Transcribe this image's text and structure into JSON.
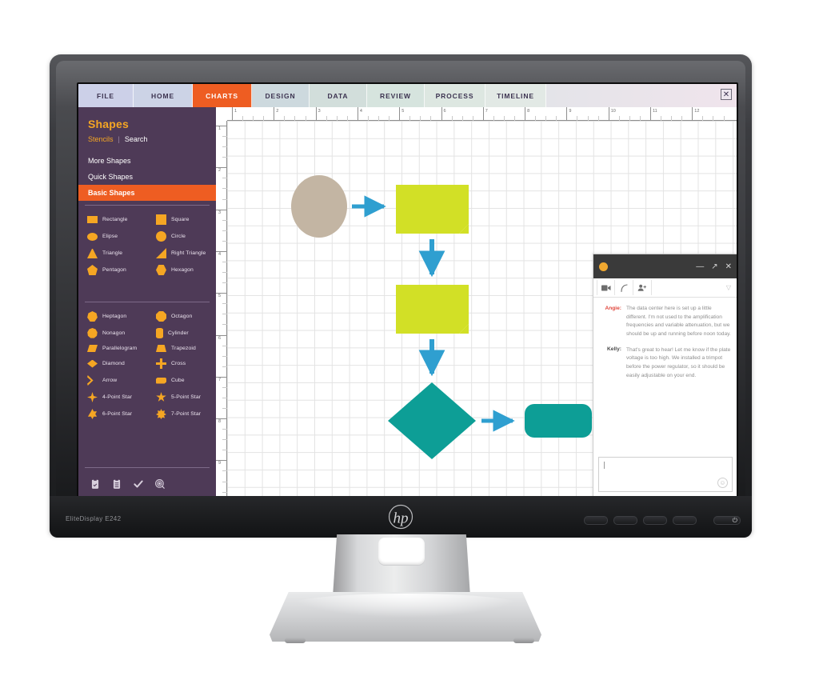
{
  "monitor": {
    "model_label": "EliteDisplay E242",
    "brand": "hp",
    "power_glyph": "⏻",
    "osd_button_count": 4
  },
  "ribbon": {
    "tabs": [
      {
        "label": "FILE",
        "active": false
      },
      {
        "label": "HOME",
        "active": false
      },
      {
        "label": "CHARTS",
        "active": true
      },
      {
        "label": "DESIGN",
        "active": false
      },
      {
        "label": "DATA",
        "active": false
      },
      {
        "label": "REVIEW",
        "active": false
      },
      {
        "label": "PROCESS",
        "active": false
      },
      {
        "label": "TIMELINE",
        "active": false
      }
    ],
    "close_label": "✕",
    "active_color": "#ee5d22"
  },
  "sidebar": {
    "title": "Shapes",
    "subnav": {
      "stencils": "Stencils",
      "separator": "|",
      "search": "Search"
    },
    "links": [
      {
        "label": "More Shapes",
        "active": false
      },
      {
        "label": "Quick Shapes",
        "active": false
      },
      {
        "label": "Basic Shapes",
        "active": true
      }
    ],
    "accent_color": "#f5a623",
    "panel_color": "#4e3a57",
    "group1": [
      {
        "label": "Rectangle",
        "shape": "rectangle"
      },
      {
        "label": "Square",
        "shape": "square"
      },
      {
        "label": "Elipse",
        "shape": "elipse"
      },
      {
        "label": "Circle",
        "shape": "circle"
      },
      {
        "label": "Triangle",
        "shape": "triangle"
      },
      {
        "label": "Right Triangle",
        "shape": "right-triangle"
      },
      {
        "label": "Pentagon",
        "shape": "pentagon"
      },
      {
        "label": "Hexagon",
        "shape": "hexagon"
      }
    ],
    "group2": [
      {
        "label": "Heptagon",
        "shape": "heptagon"
      },
      {
        "label": "Octagon",
        "shape": "octagon"
      },
      {
        "label": "Nonagon",
        "shape": "nonagon"
      },
      {
        "label": "Cylinder",
        "shape": "cylinder"
      },
      {
        "label": "Parallelogram",
        "shape": "parallelogram"
      },
      {
        "label": "Trapezoid",
        "shape": "trapezoid"
      },
      {
        "label": "Diamond",
        "shape": "diamond"
      },
      {
        "label": "Cross",
        "shape": "cross"
      },
      {
        "label": "Arrow",
        "shape": "arrow"
      },
      {
        "label": "Cube",
        "shape": "cube"
      },
      {
        "label": "4-Point Star",
        "shape": "star4"
      },
      {
        "label": "5-Point Star",
        "shape": "star5"
      },
      {
        "label": "6-Point Star",
        "shape": "star6"
      },
      {
        "label": "7-Point Star",
        "shape": "star7"
      }
    ],
    "tools": [
      {
        "icon": "clipboard-check-icon"
      },
      {
        "icon": "clipboard-icon"
      },
      {
        "icon": "checkmark-icon"
      },
      {
        "icon": "target-icon"
      }
    ]
  },
  "canvas": {
    "ruler_h_labels": [
      "1",
      "2",
      "3",
      "4",
      "5",
      "6",
      "7",
      "8",
      "9",
      "10",
      "11",
      "12"
    ],
    "ruler_v_labels": [
      "1",
      "2",
      "3",
      "4",
      "5",
      "6",
      "7",
      "8",
      "9"
    ],
    "grid": true,
    "diagram": {
      "connector_color": "#2f9fd0",
      "nodes": [
        {
          "name": "start-ellipse",
          "shape": "ellipse",
          "color": "#c3b5a3"
        },
        {
          "name": "process-node-1",
          "shape": "folded-corner",
          "color": "#d2e026"
        },
        {
          "name": "process-node-2",
          "shape": "folded-corner",
          "color": "#d2e026"
        },
        {
          "name": "decision-node",
          "shape": "diamond",
          "color": "#0d9e96"
        },
        {
          "name": "end-node",
          "shape": "rounded-rectangle",
          "color": "#0d9e96"
        }
      ],
      "connectors": [
        {
          "from": "start-ellipse",
          "to": "process-node-1",
          "direction": "right"
        },
        {
          "from": "process-node-1",
          "to": "process-node-2",
          "direction": "down"
        },
        {
          "from": "process-node-2",
          "to": "decision-node",
          "direction": "down"
        },
        {
          "from": "decision-node",
          "to": "end-node",
          "direction": "right"
        }
      ]
    }
  },
  "chat": {
    "status_icon": "status-dot-icon",
    "window_controls": {
      "minimize": "—",
      "expand": "↗",
      "close": "✕"
    },
    "tools": [
      {
        "icon": "video-camera-icon"
      },
      {
        "icon": "phone-icon"
      },
      {
        "icon": "add-person-icon"
      }
    ],
    "filter_caret": "▽",
    "messages": [
      {
        "sender": "Angie:",
        "text": "The data center here is set up a little different. I'm not used to the amplification frequencies and variable attenuation, but we should be up and running before noon today."
      },
      {
        "sender": "Kelly:",
        "text": "That's great to hear! Let me know if the plate voltage is too high. We installed a trimpot before the power regulator, so it should be easily adjustable on your end."
      }
    ],
    "input": {
      "value": "",
      "placeholder": ""
    },
    "emoji_icon": "☺"
  }
}
